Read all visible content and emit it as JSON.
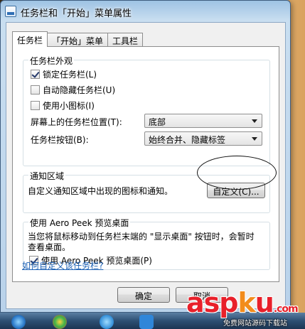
{
  "window": {
    "title": "任务栏和「开始」菜单属性"
  },
  "tabs": [
    {
      "label": "任务栏",
      "active": true
    },
    {
      "label": "「开始」菜单",
      "active": false
    },
    {
      "label": "工具栏",
      "active": false
    }
  ],
  "appearance": {
    "group_label": "任务栏外观",
    "lock_taskbar": {
      "label": "锁定任务栏(L)",
      "checked": true
    },
    "auto_hide": {
      "label": "自动隐藏任务栏(U)",
      "checked": false
    },
    "small_icons": {
      "label": "使用小图标(I)",
      "checked": false
    },
    "location": {
      "label": "屏幕上的任务栏位置(T):",
      "value": "底部"
    },
    "buttons": {
      "label": "任务栏按钮(B):",
      "value": "始终合并、隐藏标签"
    }
  },
  "notification": {
    "group_label": "通知区域",
    "description": "自定义通知区域中出现的图标和通知。",
    "customize_button": "自定义(C)..."
  },
  "aero_peek": {
    "group_label": "使用 Aero Peek 预览桌面",
    "description_line1": "当您将鼠标移动到任务栏末端的 \"显示桌面\" 按钮时，会暂时",
    "description_line2": "查看桌面。",
    "checkbox": {
      "label": "使用 Aero Peek 预览桌面(P)",
      "checked": true
    }
  },
  "help_link": "如何自定义该任务栏?",
  "footer": {
    "ok": "确定",
    "cancel": "取消"
  },
  "watermark": {
    "logo_main": "asp",
    "logo_k": "k",
    "logo_u": "u",
    "logo_suffix": ".com",
    "subtitle": "免费网站源码下载站"
  },
  "colors": {
    "link": "#1a5fb4",
    "watermark_red": "#e8202a",
    "watermark_orange": "#f28c1c"
  }
}
